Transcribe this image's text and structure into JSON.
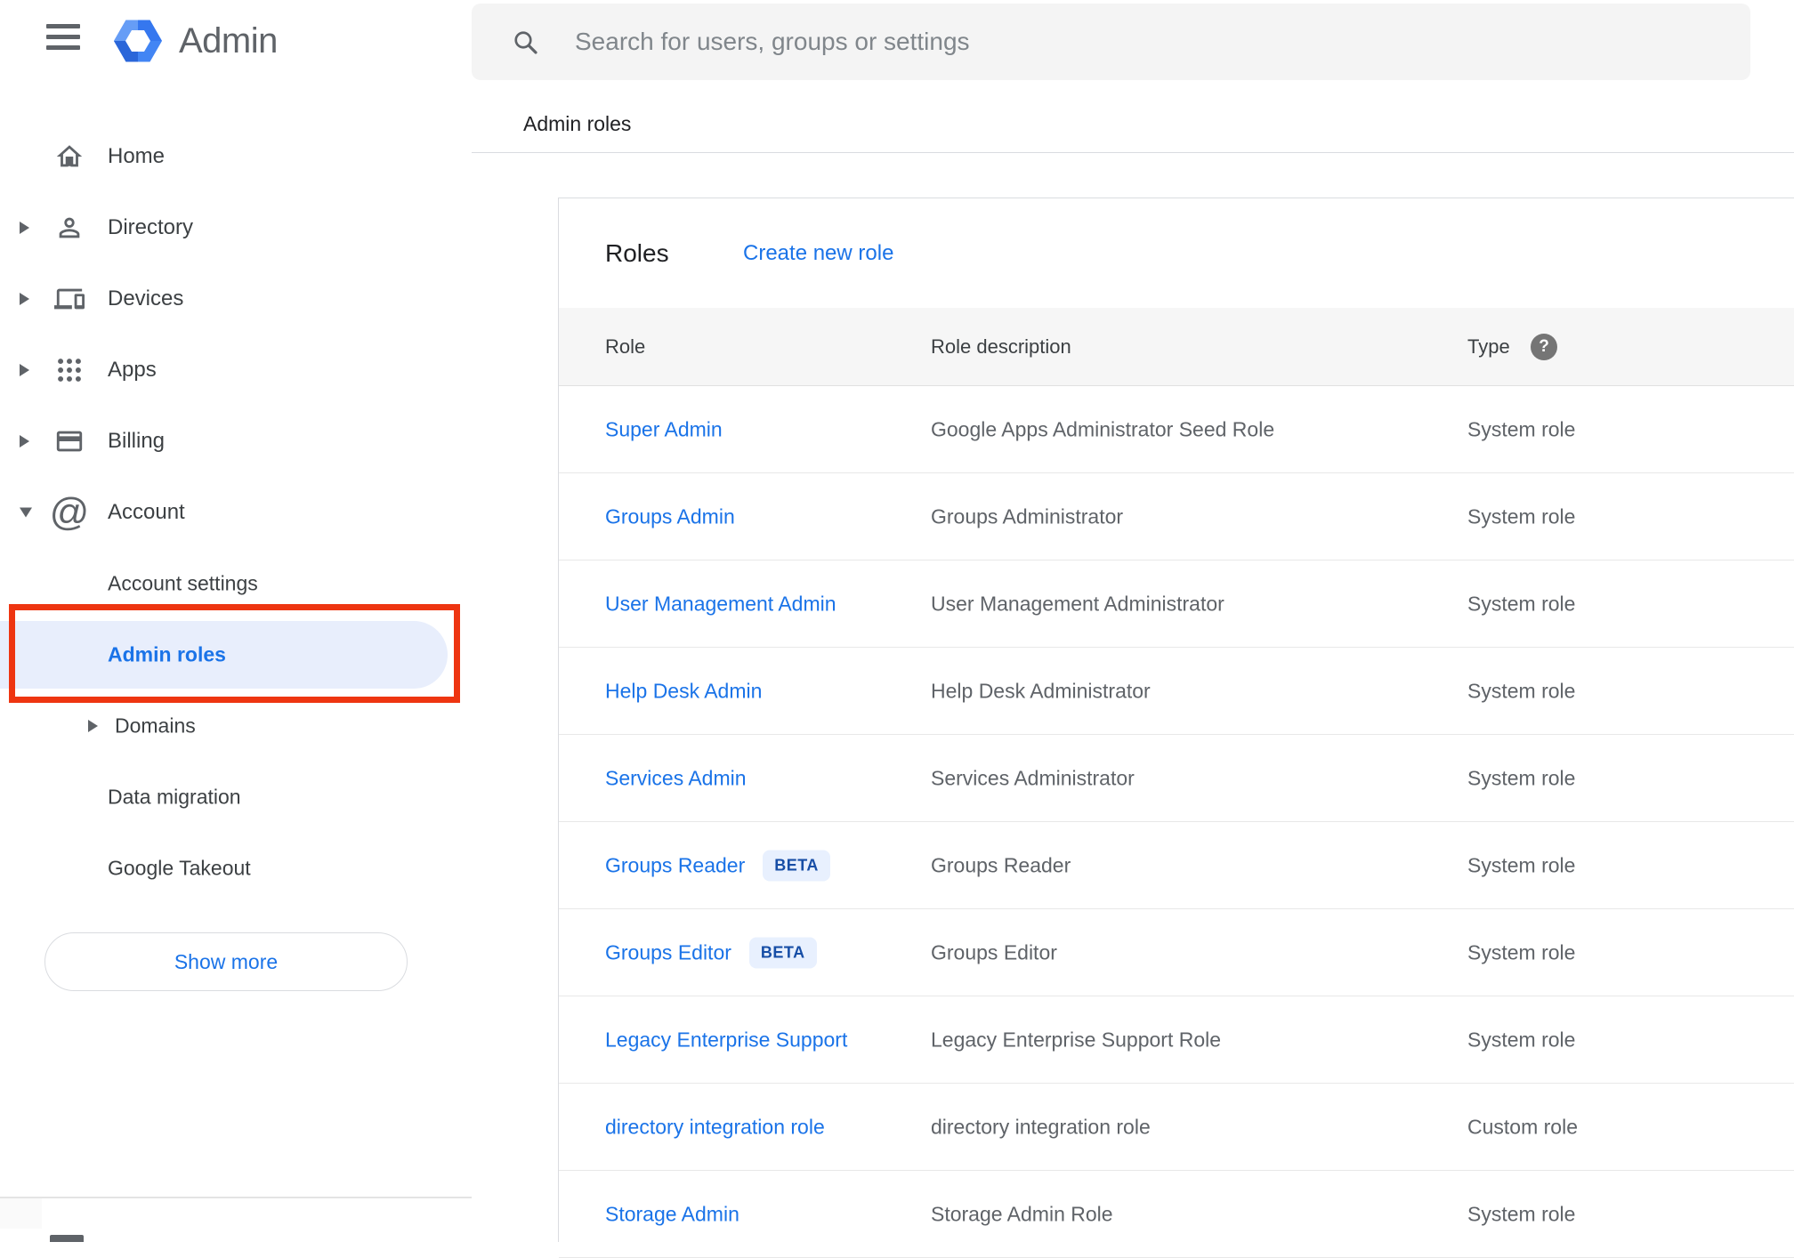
{
  "app": {
    "name": "Admin"
  },
  "topbar": {
    "search_placeholder": "Search for users, groups or settings"
  },
  "breadcrumb": "Admin roles",
  "sidebar": {
    "rows": [
      {
        "label": "Home",
        "icon": "home",
        "expander": null
      },
      {
        "label": "Directory",
        "icon": "person",
        "expander": "right"
      },
      {
        "label": "Devices",
        "icon": "devices",
        "expander": "right"
      },
      {
        "label": "Apps",
        "icon": "apps",
        "expander": "right"
      },
      {
        "label": "Billing",
        "icon": "card",
        "expander": "right"
      },
      {
        "label": "Account",
        "icon": "at",
        "expander": "down",
        "expanded": true
      },
      {
        "label": "Account settings",
        "child": true
      },
      {
        "label": "Admin roles",
        "child": true,
        "active": true,
        "annotated": true
      },
      {
        "label": "Domains",
        "child": true,
        "expander": "right"
      },
      {
        "label": "Data migration",
        "child": true
      },
      {
        "label": "Google Takeout",
        "child": true
      }
    ],
    "show_more_label": "Show more"
  },
  "main": {
    "title": "Roles",
    "create_link": "Create new role",
    "table": {
      "columns": [
        "Role",
        "Role description",
        "Type"
      ],
      "type_help_icon": "?",
      "beta_label": "BETA",
      "rows": [
        {
          "role": "Super Admin",
          "beta": false,
          "description": "Google Apps Administrator Seed Role",
          "type": "System role"
        },
        {
          "role": "Groups Admin",
          "beta": false,
          "description": "Groups Administrator",
          "type": "System role"
        },
        {
          "role": "User Management Admin",
          "beta": false,
          "description": "User Management Administrator",
          "type": "System role"
        },
        {
          "role": "Help Desk Admin",
          "beta": false,
          "description": "Help Desk Administrator",
          "type": "System role"
        },
        {
          "role": "Services Admin",
          "beta": false,
          "description": "Services Administrator",
          "type": "System role"
        },
        {
          "role": "Groups Reader",
          "beta": true,
          "description": "Groups Reader",
          "type": "System role"
        },
        {
          "role": "Groups Editor",
          "beta": true,
          "description": "Groups Editor",
          "type": "System role"
        },
        {
          "role": "Legacy Enterprise Support",
          "beta": false,
          "description": "Legacy Enterprise Support Role",
          "type": "System role"
        },
        {
          "role": "directory integration role",
          "beta": false,
          "description": "directory integration role",
          "type": "Custom role"
        },
        {
          "role": "Storage Admin",
          "beta": false,
          "description": "Storage Admin Role",
          "type": "System role"
        }
      ]
    }
  },
  "colors": {
    "accent_blue": "#1a73e8",
    "active_item_bg": "#e8eefc",
    "annotation_red": "#ee3511",
    "beta_bg": "#e8f0fe",
    "beta_text": "#174ea6",
    "header_band_bg": "#f6f6f6",
    "icon_gray": "#5f6368",
    "logo_blue": "#4285f4"
  }
}
